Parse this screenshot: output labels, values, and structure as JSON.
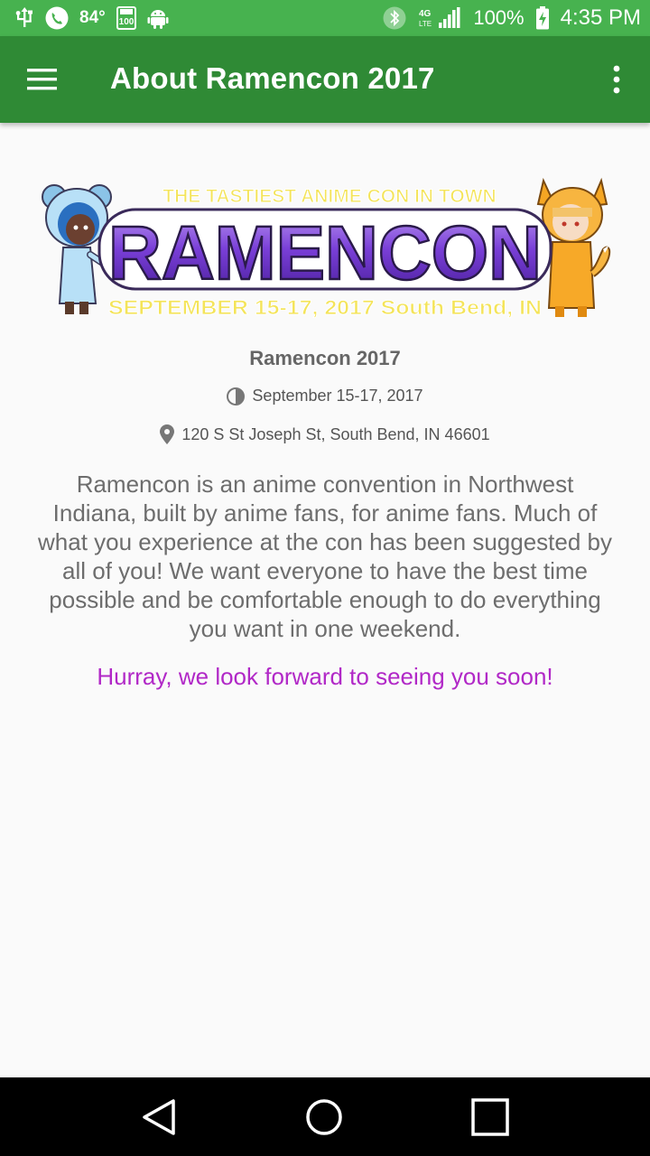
{
  "status_bar": {
    "temperature": "84°",
    "battery_percent": "100%",
    "time": "4:35 PM",
    "network_label": "4G LTE",
    "icons": [
      "usb-icon",
      "phone-call-icon",
      "storage-icon",
      "android-icon",
      "bluetooth-icon",
      "signal-icon",
      "battery-charging-icon"
    ]
  },
  "app_bar": {
    "title": "About Ramencon 2017",
    "menu_icon": "hamburger-menu-icon",
    "overflow_icon": "more-vert-icon"
  },
  "banner": {
    "tagline": "THE TASTIEST ANIME CON IN TOWN",
    "logo_text": "RAMENCON",
    "dates_line": "SEPTEMBER 15-17, 2017 South Bend, IN"
  },
  "event": {
    "name": "Ramencon 2017",
    "dates": "September 15-17, 2017",
    "address": "120 S St Joseph St, South Bend, IN 46601",
    "date_icon": "clock-icon",
    "address_icon": "location-pin-icon"
  },
  "description": "Ramencon is an anime convention in Northwest Indiana, built by anime fans, for anime fans. Much of what you experience at the con has been suggested by all of you! We want everyone to have the best time possible and be comfortable enough to do everything you want in one weekend.",
  "closing": "Hurray, we look forward to seeing you soon!",
  "colors": {
    "status_bar": "#47b24f",
    "app_bar": "#2f8a35",
    "closing_text": "#b128c7",
    "logo_purple": "#6a36c4"
  }
}
